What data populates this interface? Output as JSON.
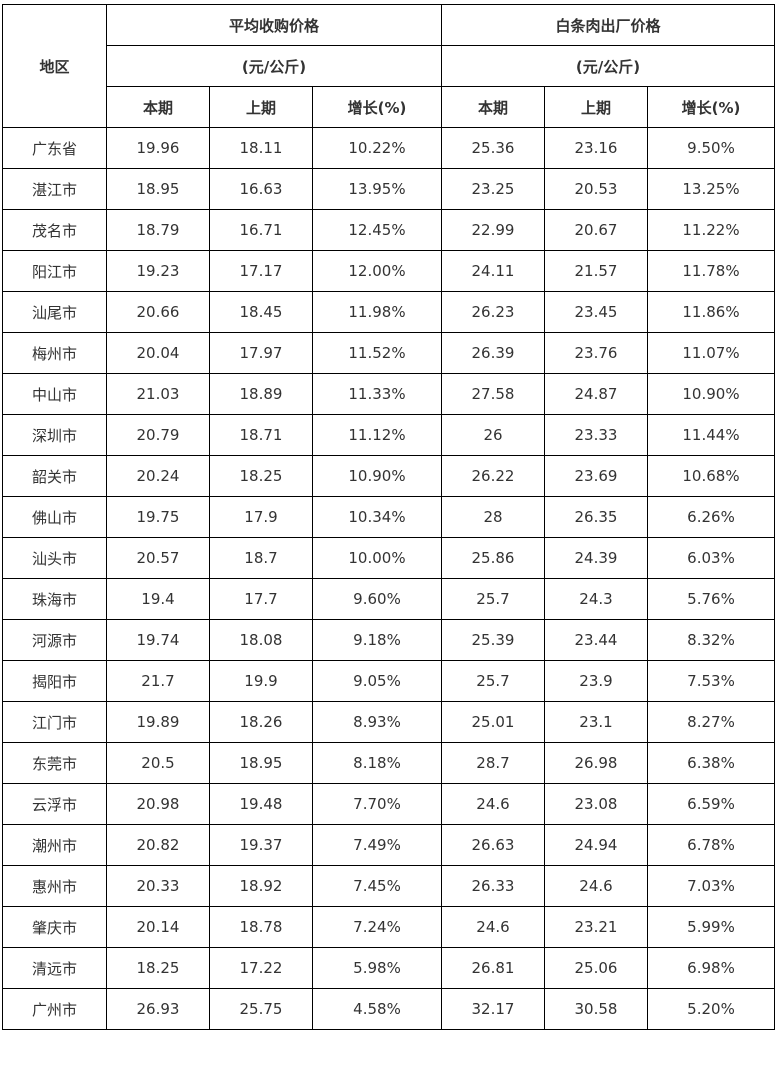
{
  "table": {
    "region_header": "地区",
    "groups": [
      {
        "title": "平均收购价格",
        "unit": "(元/公斤)"
      },
      {
        "title": "白条肉出厂价格",
        "unit": "(元/公斤)"
      }
    ],
    "subheaders": [
      "本期",
      "上期",
      "增长(%)",
      "本期",
      "上期",
      "增长(%)"
    ],
    "rows": [
      {
        "region": "广东省",
        "cells": [
          "19.96",
          "18.11",
          "10.22%",
          "25.36",
          "23.16",
          "9.50%"
        ]
      },
      {
        "region": "湛江市",
        "cells": [
          "18.95",
          "16.63",
          "13.95%",
          "23.25",
          "20.53",
          "13.25%"
        ]
      },
      {
        "region": "茂名市",
        "cells": [
          "18.79",
          "16.71",
          "12.45%",
          "22.99",
          "20.67",
          "11.22%"
        ]
      },
      {
        "region": "阳江市",
        "cells": [
          "19.23",
          "17.17",
          "12.00%",
          "24.11",
          "21.57",
          "11.78%"
        ]
      },
      {
        "region": "汕尾市",
        "cells": [
          "20.66",
          "18.45",
          "11.98%",
          "26.23",
          "23.45",
          "11.86%"
        ]
      },
      {
        "region": "梅州市",
        "cells": [
          "20.04",
          "17.97",
          "11.52%",
          "26.39",
          "23.76",
          "11.07%"
        ]
      },
      {
        "region": "中山市",
        "cells": [
          "21.03",
          "18.89",
          "11.33%",
          "27.58",
          "24.87",
          "10.90%"
        ]
      },
      {
        "region": "深圳市",
        "cells": [
          "20.79",
          "18.71",
          "11.12%",
          "26",
          "23.33",
          "11.44%"
        ]
      },
      {
        "region": "韶关市",
        "cells": [
          "20.24",
          "18.25",
          "10.90%",
          "26.22",
          "23.69",
          "10.68%"
        ]
      },
      {
        "region": "佛山市",
        "cells": [
          "19.75",
          "17.9",
          "10.34%",
          "28",
          "26.35",
          "6.26%"
        ]
      },
      {
        "region": "汕头市",
        "cells": [
          "20.57",
          "18.7",
          "10.00%",
          "25.86",
          "24.39",
          "6.03%"
        ]
      },
      {
        "region": "珠海市",
        "cells": [
          "19.4",
          "17.7",
          "9.60%",
          "25.7",
          "24.3",
          "5.76%"
        ]
      },
      {
        "region": "河源市",
        "cells": [
          "19.74",
          "18.08",
          "9.18%",
          "25.39",
          "23.44",
          "8.32%"
        ]
      },
      {
        "region": "揭阳市",
        "cells": [
          "21.7",
          "19.9",
          "9.05%",
          "25.7",
          "23.9",
          "7.53%"
        ]
      },
      {
        "region": "江门市",
        "cells": [
          "19.89",
          "18.26",
          "8.93%",
          "25.01",
          "23.1",
          "8.27%"
        ]
      },
      {
        "region": "东莞市",
        "cells": [
          "20.5",
          "18.95",
          "8.18%",
          "28.7",
          "26.98",
          "6.38%"
        ]
      },
      {
        "region": "云浮市",
        "cells": [
          "20.98",
          "19.48",
          "7.70%",
          "24.6",
          "23.08",
          "6.59%"
        ]
      },
      {
        "region": "潮州市",
        "cells": [
          "20.82",
          "19.37",
          "7.49%",
          "26.63",
          "24.94",
          "6.78%"
        ]
      },
      {
        "region": "惠州市",
        "cells": [
          "20.33",
          "18.92",
          "7.45%",
          "26.33",
          "24.6",
          "7.03%"
        ]
      },
      {
        "region": "肇庆市",
        "cells": [
          "20.14",
          "18.78",
          "7.24%",
          "24.6",
          "23.21",
          "5.99%"
        ]
      },
      {
        "region": "清远市",
        "cells": [
          "18.25",
          "17.22",
          "5.98%",
          "26.81",
          "25.06",
          "6.98%"
        ]
      },
      {
        "region": "广州市",
        "cells": [
          "26.93",
          "25.75",
          "4.58%",
          "32.17",
          "30.58",
          "5.20%"
        ]
      }
    ]
  }
}
